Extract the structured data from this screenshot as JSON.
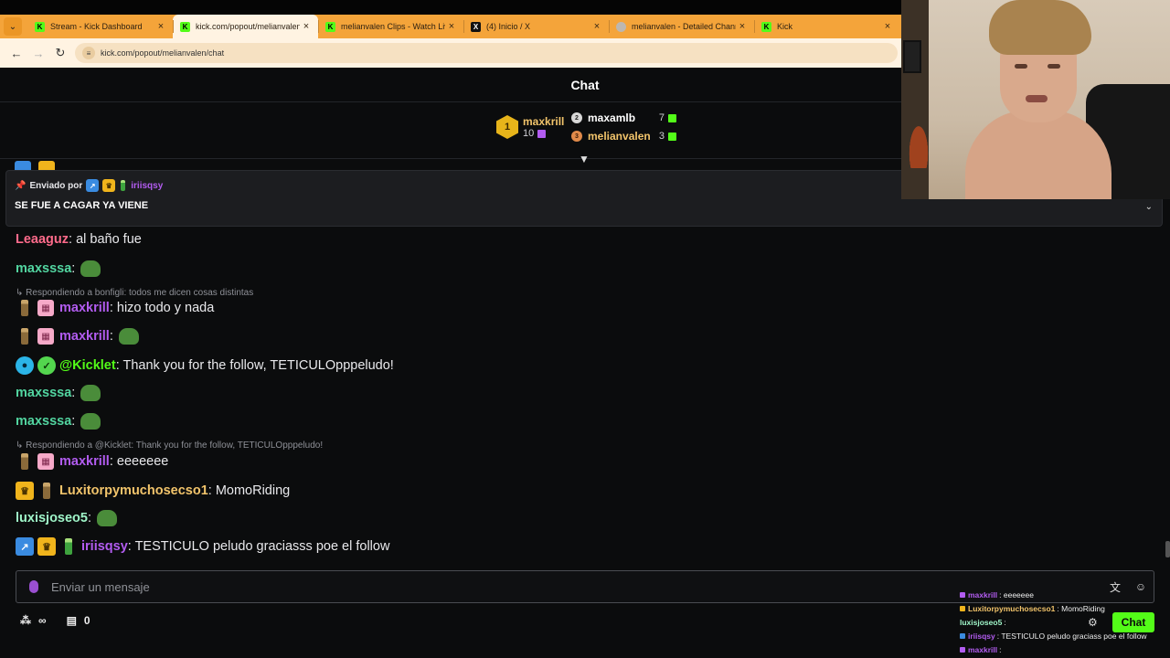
{
  "browser": {
    "tabs": [
      {
        "label": "Stream - Kick Dashboard",
        "icon": "kick-icon",
        "active": false
      },
      {
        "label": "kick.com/popout/melianvalen/c",
        "icon": "kick-icon",
        "active": true
      },
      {
        "label": "melianvalen Clips - Watch Live",
        "icon": "kick-icon",
        "active": false
      },
      {
        "label": "(4) Inicio / X",
        "icon": "x-icon",
        "active": false
      },
      {
        "label": "melianvalen - Detailed Channel",
        "icon": "site-icon",
        "active": false
      },
      {
        "label": "Kick",
        "icon": "kick-icon",
        "active": false
      }
    ],
    "url": "kick.com/popout/melianvalen/chat"
  },
  "chat": {
    "title": "Chat",
    "leaderboard": {
      "first": {
        "rank": "1",
        "name": "maxkrill",
        "count": "10"
      },
      "second": {
        "rank": "2",
        "name": "maxamlb",
        "count": "7"
      },
      "third": {
        "rank": "3",
        "name": "melianvalen",
        "count": "3"
      }
    },
    "pinned": {
      "prefix": "Enviado por",
      "user": "iriisqsy",
      "message": "SE FUE A CAGAR YA VIENE"
    },
    "messages": [
      {
        "user": "Leaaguz",
        "text": ": al baño fue"
      },
      {
        "user": "maxsssa",
        "text": ":"
      },
      {
        "reply": "Respondiendo a bonfigli: todos me dicen cosas distintas"
      },
      {
        "user": "maxkrill",
        "text": ": hizo todo y nada"
      },
      {
        "user": "maxkrill",
        "text": ":"
      },
      {
        "user": "@Kicklet",
        "text": ": Thank you for the follow, TETICULOpppeludo!"
      },
      {
        "user": "maxsssa",
        "text": ":"
      },
      {
        "user": "maxsssa",
        "text": ":"
      },
      {
        "reply": "Respondiendo a @Kicklet: Thank you for the follow, TETICULOpppeludo!"
      },
      {
        "user": "maxkrill",
        "text": ": eeeeeee"
      },
      {
        "user": "Luxitorpymuchosecso1",
        "text": ": MomoRiding"
      },
      {
        "user": "luxisjoseo5",
        "text": ":"
      },
      {
        "user": "iriisqsy",
        "text": ": TESTICULO peludo graciasss poe el follow"
      }
    ],
    "input_placeholder": "Enviar un mensaje",
    "viewers": "∞",
    "gifts": "0"
  },
  "overlay": {
    "lines": [
      {
        "user": "maxkrill",
        "text": ": eeeeeee"
      },
      {
        "user": "Luxitorpymuchosecso1",
        "text": ": MomoRiding"
      },
      {
        "user": "luxisjoseo5",
        "text": ":"
      },
      {
        "user": "iriisqsy",
        "text": ": TESTICULO peludo graciass poe el follow"
      },
      {
        "user": "maxkrill",
        "text": ":"
      }
    ],
    "chat_button": "Chat"
  },
  "colors": {
    "kick_green": "#53fc18",
    "user_pink": "#ff6b8b",
    "user_teal": "#52d5a0",
    "user_purple": "#b25cf0",
    "user_gold": "#f2c46b",
    "user_mint": "#9ff5c8",
    "tab_orange": "#f4a43a"
  }
}
